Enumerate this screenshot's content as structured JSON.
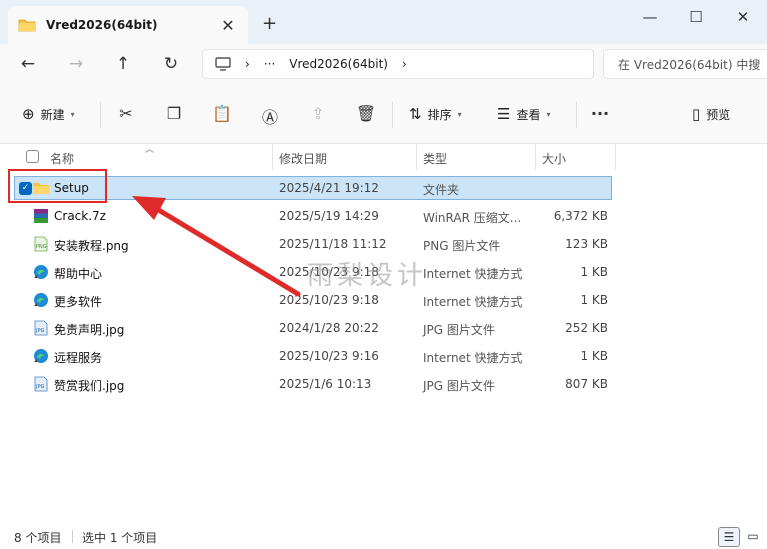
{
  "window": {
    "tab_title": "Vred2026(64bit)",
    "tab_close": "✕",
    "new_tab": "+",
    "minimize": "—",
    "maximize": "☐",
    "close": "✕"
  },
  "nav": {
    "back_icon": "←",
    "forward_icon": "→",
    "up_icon": "↑",
    "refresh_icon": "↻",
    "address_ellipsis": "···",
    "address_crumb": "Vred2026(64bit)",
    "search_placeholder": "在 Vred2026(64bit) 中搜"
  },
  "toolbar": {
    "new_label": "新建",
    "sort_label": "排序",
    "view_label": "查看",
    "more_label": "···",
    "preview_label": "预览"
  },
  "columns": {
    "name": "名称",
    "date": "修改日期",
    "type": "类型",
    "size": "大小"
  },
  "files": [
    {
      "name": "Setup",
      "date": "2025/4/21 19:12",
      "type": "文件夹",
      "size": "",
      "icon": "folder-icon",
      "selected": true
    },
    {
      "name": "Crack.7z",
      "date": "2025/5/19 14:29",
      "type": "WinRAR 压缩文...",
      "size": "6,372 KB",
      "icon": "winrar-archive-icon",
      "selected": false
    },
    {
      "name": "安装教程.png",
      "date": "2025/11/18 11:12",
      "type": "PNG 图片文件",
      "size": "123 KB",
      "icon": "png-image-icon",
      "selected": false
    },
    {
      "name": "帮助中心",
      "date": "2025/10/23 9:18",
      "type": "Internet 快捷方式",
      "size": "1 KB",
      "icon": "edge-shortcut-icon",
      "selected": false
    },
    {
      "name": "更多软件",
      "date": "2025/10/23 9:18",
      "type": "Internet 快捷方式",
      "size": "1 KB",
      "icon": "edge-shortcut-icon",
      "selected": false
    },
    {
      "name": "免责声明.jpg",
      "date": "2024/1/28 20:22",
      "type": "JPG 图片文件",
      "size": "252 KB",
      "icon": "jpg-image-icon",
      "selected": false
    },
    {
      "name": "远程服务",
      "date": "2025/10/23 9:16",
      "type": "Internet 快捷方式",
      "size": "1 KB",
      "icon": "edge-shortcut-icon",
      "selected": false
    },
    {
      "name": "赞赏我们.jpg",
      "date": "2025/1/6 10:13",
      "type": "JPG 图片文件",
      "size": "807 KB",
      "icon": "jpg-image-icon",
      "selected": false
    }
  ],
  "watermark": "雨梨设计",
  "status": {
    "count": "8 个项目",
    "selected": "选中 1 个项目"
  },
  "colors": {
    "accent": "#0067c0",
    "selection_bg": "#cce4f7",
    "annotation_red": "#e02a2a",
    "folder_yellow": "#f5c342"
  }
}
